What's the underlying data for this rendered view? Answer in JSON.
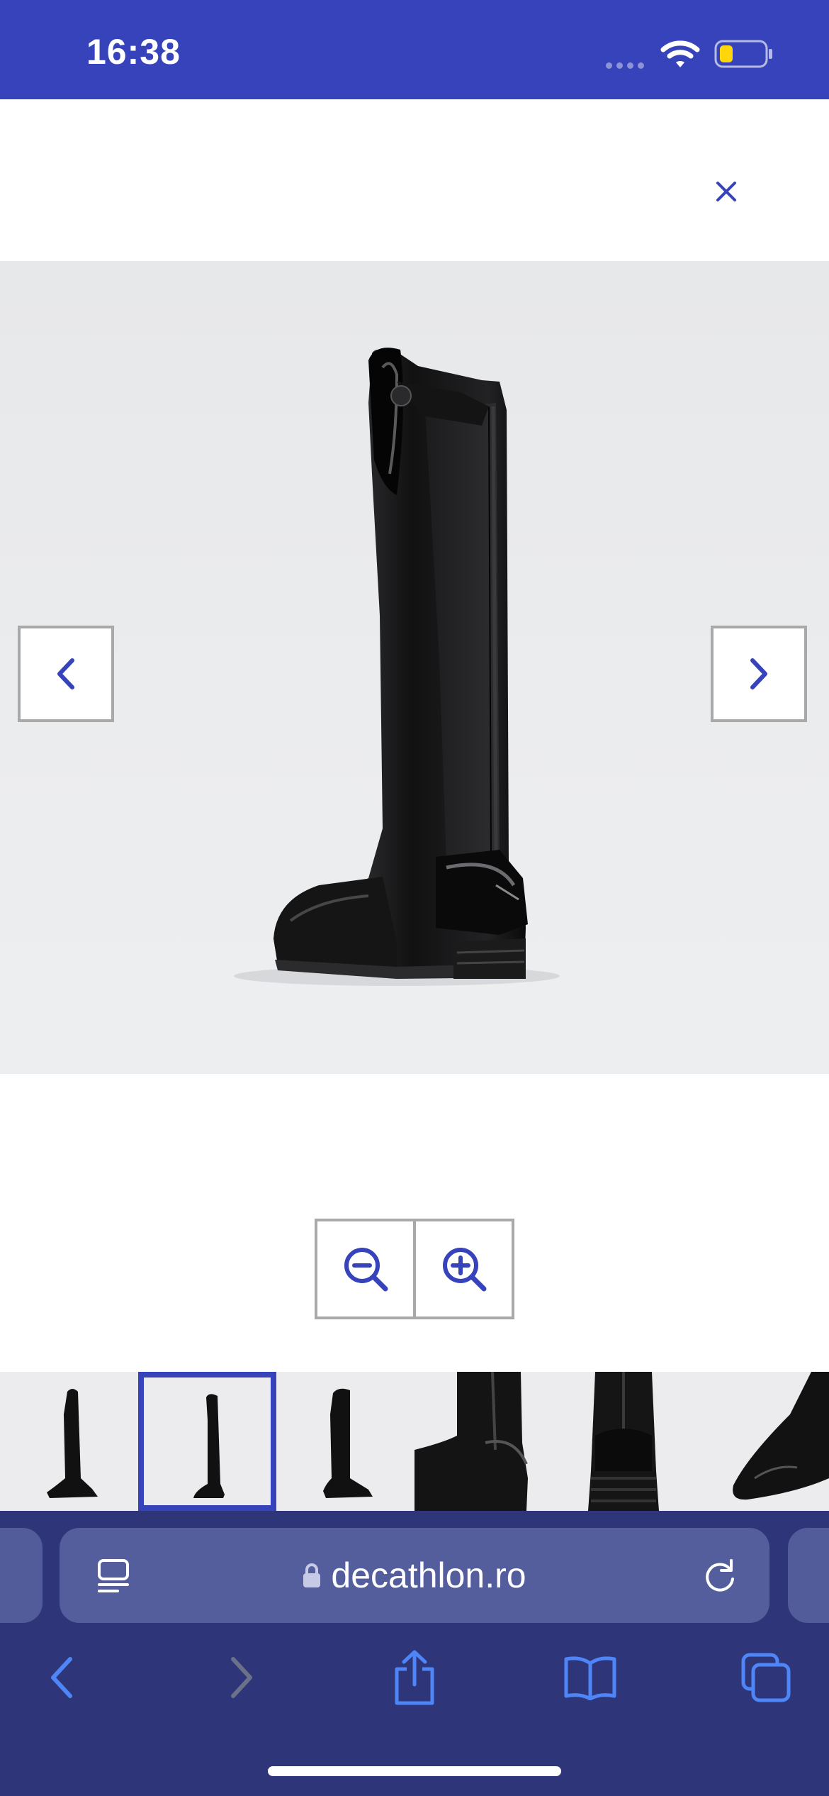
{
  "status_bar": {
    "time": "16:38",
    "icons": [
      "signal-dots-icon",
      "wifi-icon",
      "battery-low-icon"
    ],
    "battery_fill_fraction": 0.3,
    "background": "#3643ba"
  },
  "viewer": {
    "close_icon": "close-icon",
    "prev_icon": "chevron-left-icon",
    "next_icon": "chevron-right-icon",
    "zoom_out_icon": "zoom-out-icon",
    "zoom_in_icon": "zoom-in-icon",
    "accent_color": "#3643ba",
    "image_description_icon": "riding-boot-image"
  },
  "thumbnails": {
    "selected_index": 1,
    "items": [
      {
        "icon": "boot-thumbnail"
      },
      {
        "icon": "boot-thumbnail"
      },
      {
        "icon": "boot-thumbnail"
      },
      {
        "icon": "boot-heel-thumbnail"
      },
      {
        "icon": "boot-back-thumbnail"
      },
      {
        "icon": "boot-toe-thumbnail"
      }
    ]
  },
  "browser": {
    "url": "decathlon.ro",
    "toolbar_icons": [
      "back-icon",
      "forward-icon",
      "share-icon",
      "bookmarks-icon",
      "tabs-icon"
    ],
    "tint": "#2e3679"
  }
}
